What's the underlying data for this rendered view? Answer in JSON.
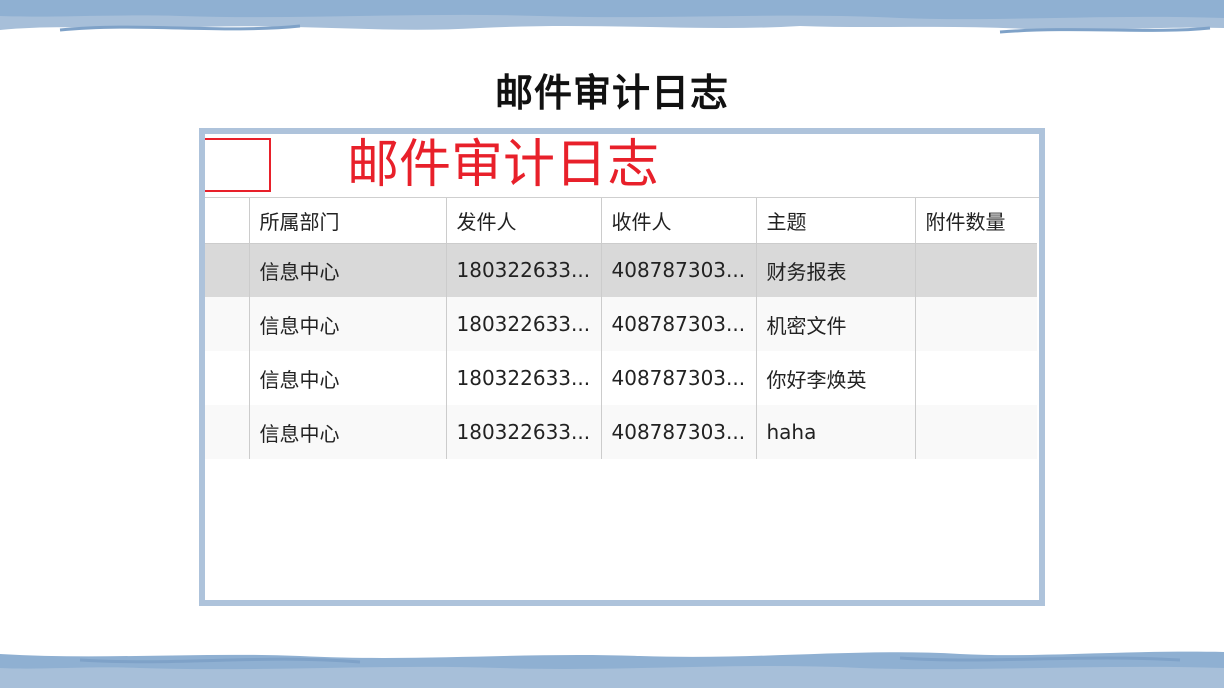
{
  "slide": {
    "title": "邮件审计日志"
  },
  "app": {
    "header_title": "邮件审计日志"
  },
  "table": {
    "columns": [
      "所属部门",
      "发件人",
      "收件人",
      "主题",
      "附件数量"
    ],
    "rows": [
      [
        "信息中心",
        "180322633...",
        "408787303...",
        "财务报表",
        ""
      ],
      [
        "信息中心",
        "180322633...",
        "408787303...",
        "机密文件",
        ""
      ],
      [
        "信息中心",
        "180322633...",
        "408787303...",
        "你好李焕英",
        ""
      ],
      [
        "信息中心",
        "180322633...",
        "408787303...",
        "haha",
        ""
      ]
    ],
    "selected_row": 0
  },
  "colors": {
    "accent_red": "#e8202a",
    "frame_blue": "#aec3db",
    "brush_blue": "#8fb0d2",
    "selected_row": "#d9d9d9"
  }
}
